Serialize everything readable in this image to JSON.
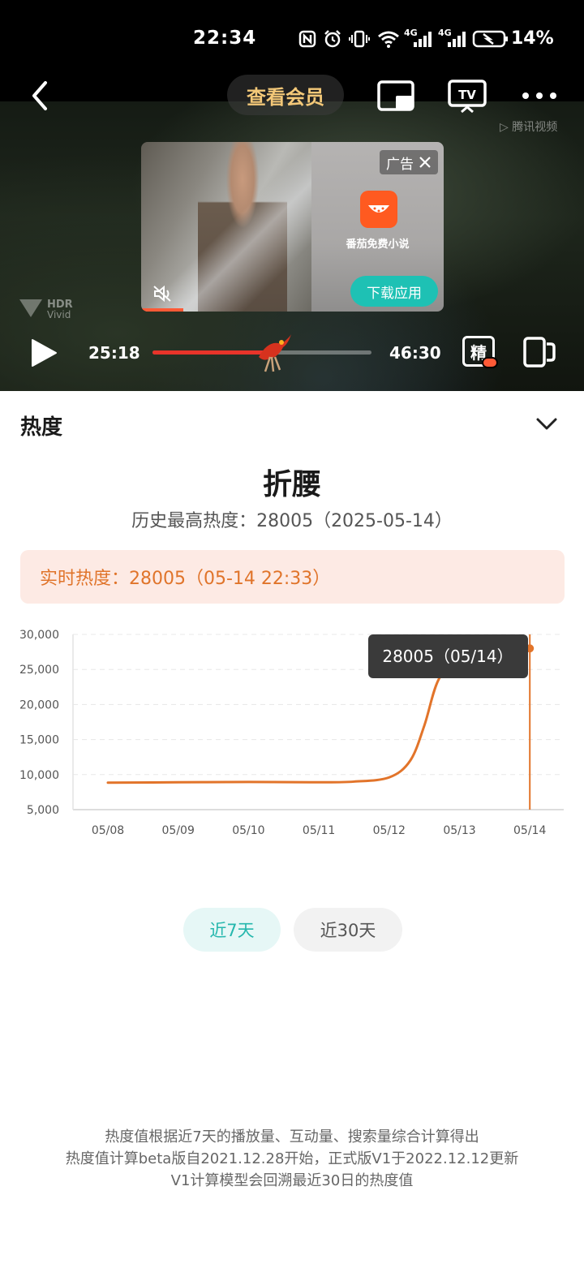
{
  "status_bar": {
    "time": "22:34",
    "network_1": "4G",
    "network_2": "4G",
    "battery": "14%"
  },
  "player": {
    "vip_label": "查看会员",
    "watermark": "腾讯视频",
    "hdr_label": "HDR Vivid",
    "current_time": "25:18",
    "total_time": "46:30",
    "progress_fraction": 0.544,
    "quality_label": "精",
    "icons": [
      "back-icon",
      "pip-icon",
      "tv-cast-icon",
      "more-icon",
      "play-icon",
      "rotate-icon",
      "mute-icon"
    ]
  },
  "ad": {
    "label": "广告",
    "app_name": "番茄免费小说",
    "download_label": "下载应用"
  },
  "heat_panel": {
    "title": "热度",
    "show_title": "折腰",
    "history_text": "历史最高热度：28005（2025-05-14）",
    "realtime_text": "实时热度：28005（05-14 22:33）",
    "tabs": [
      {
        "label": "近7天",
        "selected": true
      },
      {
        "label": "近30天",
        "selected": false
      }
    ],
    "footnotes": [
      "热度值根据近7天的播放量、互动量、搜索量综合计算得出",
      "热度值计算beta版自2021.12.28开始，正式版V1于2022.12.12更新",
      "V1计算模型会回溯最近30日的热度值"
    ]
  },
  "chart_data": {
    "type": "line",
    "x": [
      "05/08",
      "05/09",
      "05/10",
      "05/11",
      "05/12",
      "05/12",
      "05/13",
      "05/14"
    ],
    "categories": [
      "05/08",
      "05/09",
      "05/10",
      "05/11",
      "05/12",
      "05/13",
      "05/14"
    ],
    "series": [
      {
        "values_points": [
          [
            0,
            8850
          ],
          [
            1,
            8900
          ],
          [
            2,
            8950
          ],
          [
            3,
            8900
          ],
          [
            3.5,
            9000
          ],
          [
            4,
            9600
          ],
          [
            4.3,
            12000
          ],
          [
            4.5,
            17000
          ],
          [
            4.7,
            23500
          ],
          [
            5,
            27000
          ],
          [
            5.5,
            27600
          ],
          [
            6,
            28005
          ]
        ],
        "color": "#e2742a"
      }
    ],
    "ylim": [
      5000,
      30000
    ],
    "yticks": [
      "5,000",
      "10,000",
      "15,000",
      "20,000",
      "25,000",
      "30,000"
    ],
    "ytick_values": [
      5000,
      10000,
      15000,
      20000,
      25000,
      30000
    ],
    "grid": true,
    "tooltip": "28005（05/14）",
    "highlight_index": 6
  }
}
